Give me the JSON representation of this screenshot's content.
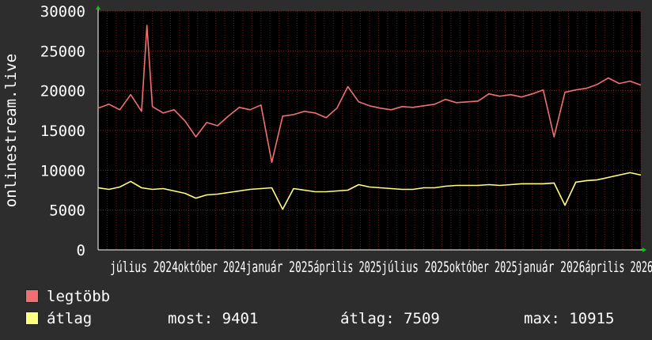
{
  "chart_data": {
    "type": "line",
    "ylabel": "onlinestream.live",
    "ylim": [
      0,
      30000
    ],
    "yticks": [
      0,
      5000,
      10000,
      15000,
      20000,
      25000,
      30000
    ],
    "ytick_labels": [
      "0",
      "5000",
      "10000",
      "15000",
      "20000",
      "25000",
      "30000"
    ],
    "xtick_labels": [
      "július 2024",
      "október 2024",
      "január 2025",
      "április 2025",
      "július 2025",
      "október 2025",
      "január 2026",
      "április 2026"
    ],
    "xlim": [
      0,
      100
    ],
    "grid": true,
    "background": "#000000",
    "grid_color": "#8b2020",
    "series": [
      {
        "name": "legtöbb",
        "color": "#f07070",
        "x": [
          0,
          2,
          4,
          6,
          8,
          9,
          10,
          12,
          14,
          16,
          18,
          20,
          22,
          24,
          26,
          28,
          30,
          32,
          34,
          36,
          38,
          40,
          42,
          44,
          46,
          48,
          50,
          52,
          54,
          56,
          58,
          60,
          62,
          64,
          66,
          68,
          70,
          72,
          74,
          76,
          78,
          80,
          82,
          84,
          86,
          88,
          90,
          92,
          94,
          96,
          98,
          100
        ],
        "values": [
          17800,
          18300,
          17600,
          19500,
          17400,
          28200,
          18000,
          17200,
          17600,
          16200,
          14200,
          16000,
          15600,
          16800,
          17900,
          17600,
          18200,
          11000,
          16800,
          17000,
          17400,
          17200,
          16600,
          17800,
          20500,
          18600,
          18100,
          17800,
          17600,
          18000,
          17900,
          18100,
          18300,
          18900,
          18500,
          18600,
          18700,
          19600,
          19300,
          19500,
          19200,
          19600,
          20100,
          14200,
          19800,
          20100,
          20300,
          20800,
          21600,
          20900,
          21200,
          20700
        ]
      },
      {
        "name": "átlag",
        "color": "#ffff80",
        "x": [
          0,
          2,
          4,
          6,
          8,
          10,
          12,
          14,
          16,
          18,
          20,
          22,
          24,
          26,
          28,
          30,
          32,
          34,
          36,
          38,
          40,
          42,
          44,
          46,
          48,
          50,
          52,
          54,
          56,
          58,
          60,
          62,
          64,
          66,
          68,
          70,
          72,
          74,
          76,
          78,
          80,
          82,
          84,
          86,
          88,
          90,
          92,
          94,
          96,
          98,
          100
        ],
        "values": [
          7800,
          7600,
          7900,
          8600,
          7800,
          7600,
          7700,
          7400,
          7100,
          6500,
          6900,
          7000,
          7200,
          7400,
          7600,
          7700,
          7800,
          5100,
          7700,
          7500,
          7300,
          7300,
          7400,
          7500,
          8200,
          7900,
          7800,
          7700,
          7600,
          7600,
          7800,
          7800,
          8000,
          8100,
          8100,
          8100,
          8200,
          8100,
          8200,
          8300,
          8300,
          8300,
          8400,
          5600,
          8500,
          8700,
          8800,
          9100,
          9400,
          9700,
          9401
        ]
      }
    ],
    "legend": [
      {
        "label": "legtöbb",
        "color": "#f07070"
      },
      {
        "label": "átlag",
        "color": "#ffff80"
      }
    ],
    "stats": {
      "most": "most: 9401",
      "atlag": "átlag: 7509",
      "max": "max: 10915"
    }
  }
}
